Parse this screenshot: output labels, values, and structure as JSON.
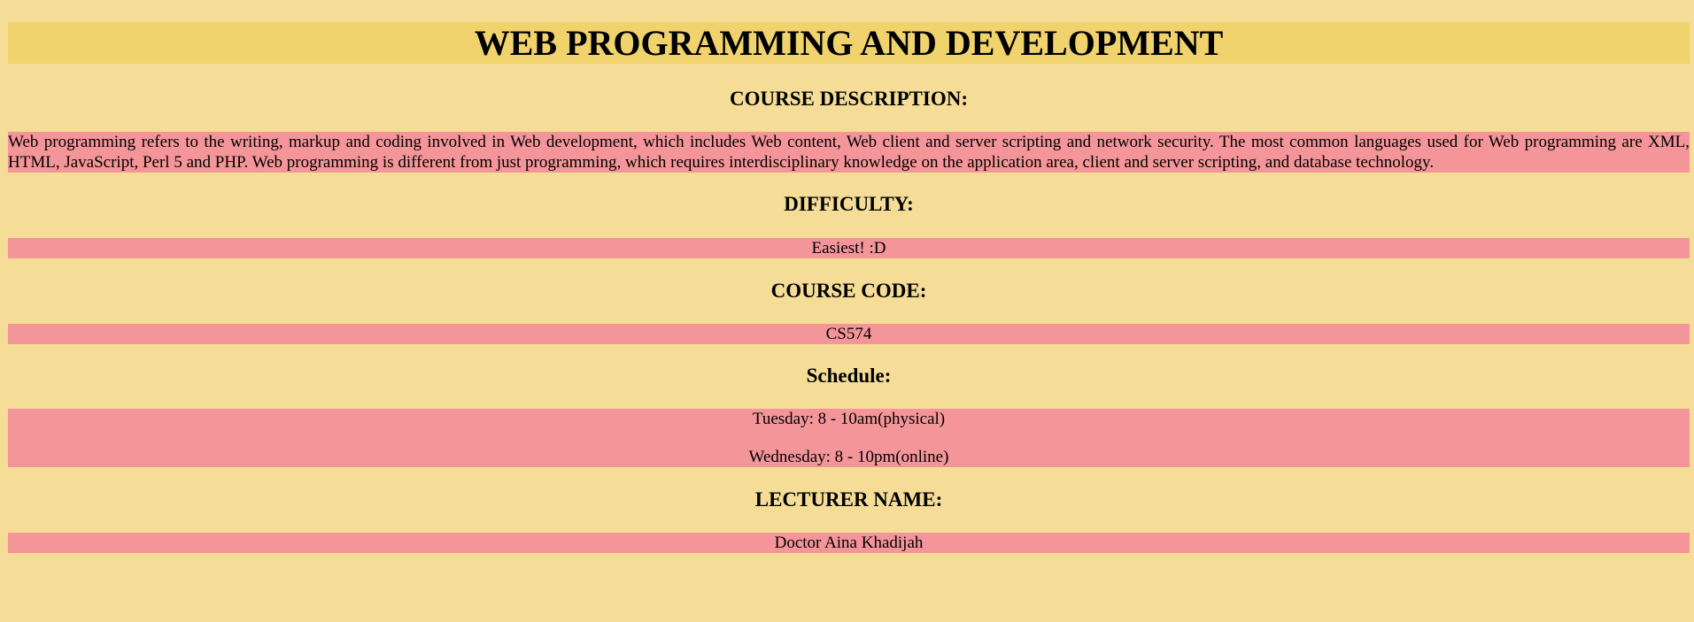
{
  "page": {
    "title": "WEB PROGRAMMING AND DEVELOPMENT"
  },
  "description": {
    "heading": "COURSE DESCRIPTION:",
    "text": "Web programming refers to the writing, markup and coding involved in Web development, which includes Web content, Web client and server scripting and network security. The most common languages used for Web programming are XML, HTML, JavaScript, Perl 5 and PHP. Web programming is different from just programming, which requires interdisciplinary knowledge on the application area, client and server scripting, and database technology."
  },
  "difficulty": {
    "heading": "DIFFICULTY:",
    "value": "Easiest! :D"
  },
  "course_code": {
    "heading": "COURSE CODE:",
    "value": "CS574"
  },
  "schedule": {
    "heading": "Schedule:",
    "items": [
      "Tuesday: 8 - 10am(physical)",
      "Wednesday: 8 - 10pm(online)"
    ]
  },
  "lecturer": {
    "heading": "LECTURER NAME:",
    "value": "Doctor Aina Khadijah"
  },
  "colors": {
    "background": "#F5DD97",
    "title_bar": "#F0D36C",
    "content_box": "#F4959A"
  }
}
